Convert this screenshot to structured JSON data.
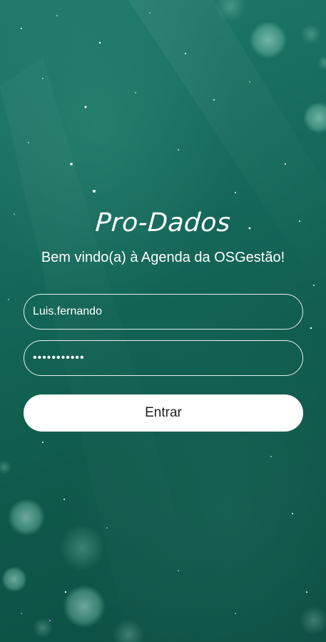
{
  "app": {
    "title": "Pro-Dados",
    "welcome_message": "Bem vindo(a) à Agenda da OSGestão!"
  },
  "login": {
    "username_value": "Luis.fernando",
    "password_value": "sistema2019",
    "submit_label": "Entrar"
  },
  "colors": {
    "background_top": "#1f7a6a",
    "background_bottom": "#0c4d42",
    "field_border": "#ffffff",
    "button_background": "#ffffff",
    "button_text": "#1f1f1f"
  }
}
